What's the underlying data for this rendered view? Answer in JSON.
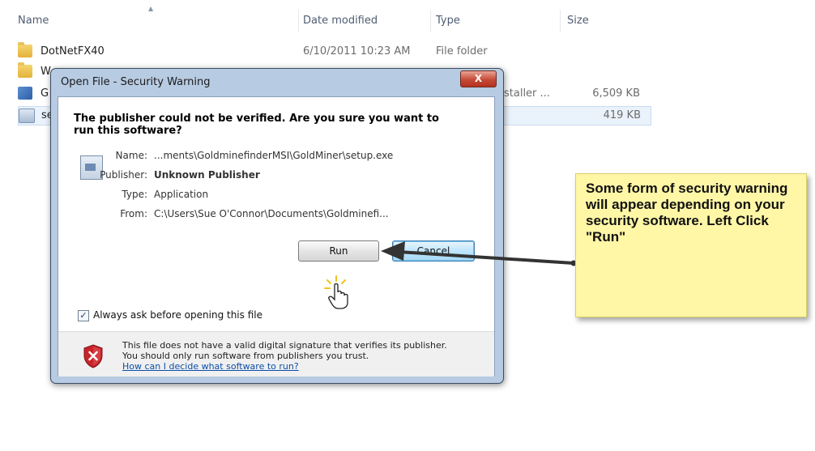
{
  "explorer": {
    "columns": {
      "name": "Name",
      "date": "Date modified",
      "type": "Type",
      "size": "Size"
    },
    "rows": [
      {
        "name": "DotNetFX40",
        "date": "6/10/2011 10:23 AM",
        "type": "File folder",
        "size": ""
      },
      {
        "name": "W",
        "date": "",
        "type": "",
        "size": ""
      },
      {
        "name": "G",
        "date": "",
        "type": "staller ...",
        "size": "6,509 KB"
      },
      {
        "name": "se",
        "date": "",
        "type": "",
        "size": "419 KB"
      }
    ]
  },
  "dialog": {
    "title": "Open File - Security Warning",
    "close_label": "X",
    "question": "The publisher could not be verified.  Are you sure you want to run this software?",
    "fields": [
      {
        "key": "Name:",
        "value": "...ments\\GoldminefinderMSI\\GoldMiner\\setup.exe"
      },
      {
        "key": "Publisher:",
        "value": "Unknown Publisher"
      },
      {
        "key": "Type:",
        "value": "Application"
      },
      {
        "key": "From:",
        "value": "C:\\Users\\Sue O'Connor\\Documents\\Goldminefi..."
      }
    ],
    "run_label": "Run",
    "cancel_label": "Cancel",
    "checkbox_label": "Always ask before opening this file",
    "checkbox_checked": true,
    "warning_text": "This file does not have a valid digital signature that verifies its publisher.  You should only run software from publishers you trust.",
    "help_link": "How can I decide what software to run?"
  },
  "callout": {
    "text": "Some form of security warning will appear depending on your security software. Left Click \"Run\""
  },
  "colors": {
    "note_bg": "#fff6a6",
    "cancel_focus": "#a7d9f5",
    "close_red": "#c64a37"
  }
}
